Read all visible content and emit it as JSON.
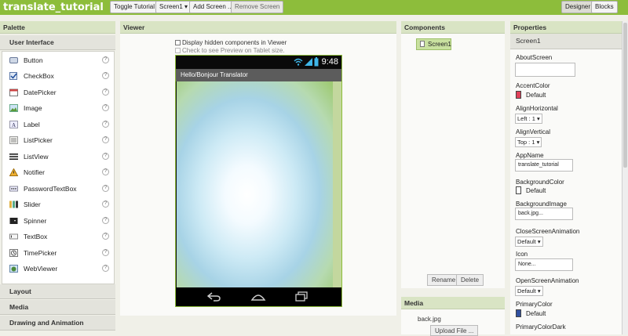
{
  "app": {
    "title": "translate_tutorial"
  },
  "toolbar": {
    "toggle_tutorial": "Toggle Tutorial",
    "screen_select": "Screen1 ▾",
    "add_screen": "Add Screen ...",
    "remove_screen": "Remove Screen",
    "designer": "Designer",
    "blocks": "Blocks"
  },
  "palette": {
    "title": "Palette",
    "section": "User Interface",
    "items": [
      {
        "label": "Button",
        "icon": "button-icon"
      },
      {
        "label": "CheckBox",
        "icon": "checkbox-icon"
      },
      {
        "label": "DatePicker",
        "icon": "datepicker-icon"
      },
      {
        "label": "Image",
        "icon": "image-icon"
      },
      {
        "label": "Label",
        "icon": "label-icon"
      },
      {
        "label": "ListPicker",
        "icon": "listpicker-icon"
      },
      {
        "label": "ListView",
        "icon": "listview-icon"
      },
      {
        "label": "Notifier",
        "icon": "notifier-icon"
      },
      {
        "label": "PasswordTextBox",
        "icon": "password-icon"
      },
      {
        "label": "Slider",
        "icon": "slider-icon"
      },
      {
        "label": "Spinner",
        "icon": "spinner-icon"
      },
      {
        "label": "TextBox",
        "icon": "textbox-icon"
      },
      {
        "label": "TimePicker",
        "icon": "timepicker-icon"
      },
      {
        "label": "WebViewer",
        "icon": "webviewer-icon"
      }
    ],
    "help_glyph": "?",
    "categories": [
      "Layout",
      "Media",
      "Drawing and Animation"
    ]
  },
  "viewer": {
    "title": "Viewer",
    "hidden_components": "Display hidden components in Viewer",
    "tablet_preview": "Check to see Preview on Tablet size.",
    "clock": "9:48",
    "screen_title": "Hello/Bonjour Translator"
  },
  "components": {
    "title": "Components",
    "root": "Screen1",
    "rename": "Rename",
    "delete": "Delete"
  },
  "media": {
    "title": "Media",
    "file": "back.jpg",
    "upload": "Upload File ..."
  },
  "properties": {
    "title": "Properties",
    "component": "Screen1",
    "about_screen": "AboutScreen",
    "accent_color": "AccentColor",
    "accent_value": "Default",
    "accent_hex": "#e0405a",
    "align_horizontal": "AlignHorizontal",
    "align_horizontal_value": "Left : 1 ▾",
    "align_vertical": "AlignVertical",
    "align_vertical_value": "Top : 1 ▾",
    "app_name": "AppName",
    "app_name_value": "translate_tutorial",
    "background_color": "BackgroundColor",
    "background_color_value": "Default",
    "background_image": "BackgroundImage",
    "background_image_value": "back.jpg...",
    "close_anim": "CloseScreenAnimation",
    "close_anim_value": "Default ▾",
    "icon": "Icon",
    "icon_value": "None...",
    "open_anim": "OpenScreenAnimation",
    "open_anim_value": "Default ▾",
    "primary_color": "PrimaryColor",
    "primary_color_value": "Default",
    "primary_hex": "#3050a0",
    "primary_dark": "PrimaryColorDark"
  }
}
